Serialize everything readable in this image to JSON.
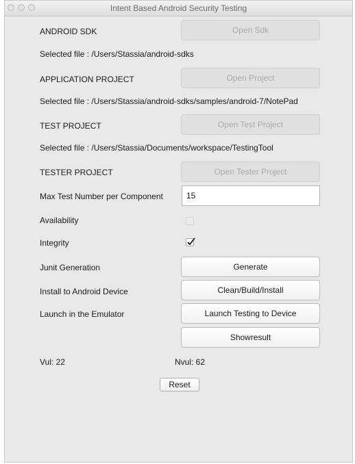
{
  "window": {
    "title": "Intent Based Android Security Testing"
  },
  "rows": {
    "sdk": {
      "label": "ANDROID SDK",
      "button": "Open Sdk",
      "selected": "Selected file : /Users/Stassia/android-sdks"
    },
    "app": {
      "label": "APPLICATION PROJECT",
      "button": "Open Project",
      "selected": "Selected file : /Users/Stassia/android-sdks/samples/android-7/NotePad"
    },
    "test": {
      "label": "TEST PROJECT",
      "button": "Open Test Project",
      "selected": "Selected file : /Users/Stassia/Documents/workspace/TestingTool"
    },
    "tester": {
      "label": "TESTER PROJECT",
      "button": "Open Tester Project"
    }
  },
  "max_test": {
    "label": "Max Test Number per Component",
    "value": "15"
  },
  "availability": {
    "label": "Availability",
    "checked": false
  },
  "integrity": {
    "label": "Integrity",
    "checked": true
  },
  "junit": {
    "label": "Junit Generation",
    "button": "Generate"
  },
  "install": {
    "label": "Install to Android Device",
    "button": "Clean/Build/Install"
  },
  "launch": {
    "label": "Launch in the Emulator",
    "button": "Launch Testing to Device"
  },
  "showresult": {
    "button": "Showresult"
  },
  "stats": {
    "vul": "Vul:  22",
    "nvul": "Nvul:  62"
  },
  "reset": {
    "button": "Reset"
  }
}
